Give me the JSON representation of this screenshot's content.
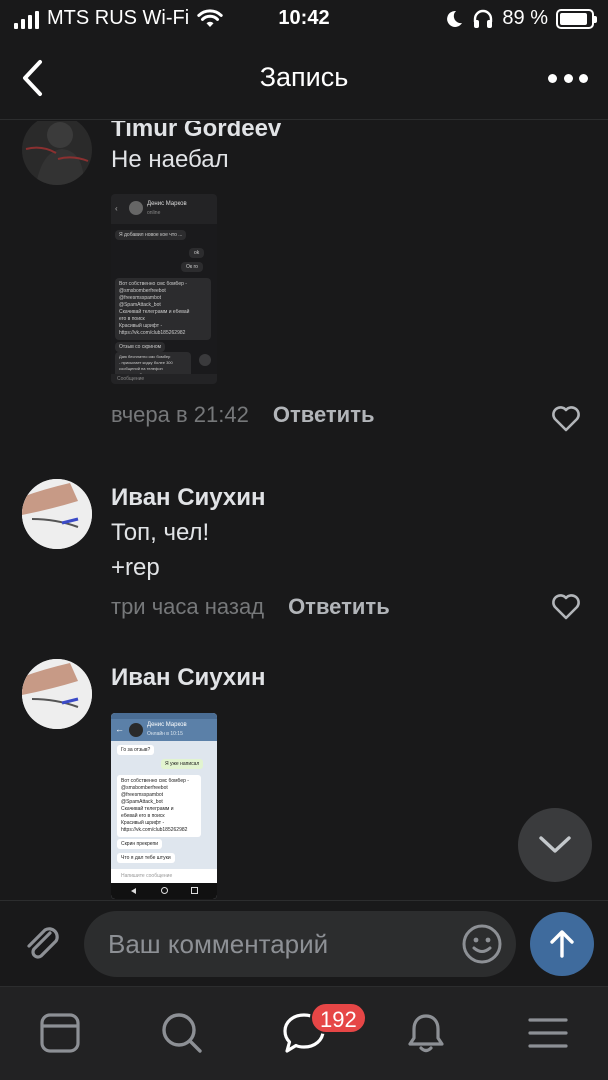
{
  "status_bar": {
    "carrier": "MTS RUS Wi-Fi",
    "time": "10:42",
    "battery": "89 %",
    "battery_level": 0.89
  },
  "header": {
    "title": "Запись",
    "back_icon": "chevron-left-icon",
    "more_icon": "more-horizontal-icon"
  },
  "comments": [
    {
      "author": "Timur Gordeev",
      "text": "Не наебал",
      "time": "вчера в 21:42",
      "reply": "Ответить",
      "attachment": {
        "chat_name": "Денис Марков",
        "chat_status": "online",
        "msg_1": "Я добавил новое кое что ...",
        "msg_2": "ok",
        "msg_3": "Ок го",
        "msg_4_lines": [
          "Вот собственно смс бомбер -",
          "@smsbomberfreebot",
          "@freesmsspambot",
          "@SpamAttack_bot",
          "Скачивай телеграмм и ебевай",
          "его в поиск",
          "Красивый шрифт -",
          "https://vk.com/club185262982"
        ],
        "msg_5": "Отзыв со скрином",
        "msg_6_lines": [
          "Даю бесплатно смс бомбер",
          "- присылает кидку более 300",
          "сообщений на телефон",
          "также даю бесплатно кое"
        ],
        "input_placeholder": "Сообщение"
      }
    },
    {
      "author": "Иван Сиухин",
      "text_lines": [
        "Топ, чел!",
        "+rep"
      ],
      "time": "три часа назад",
      "reply": "Ответить"
    },
    {
      "author": "Иван Сиухин",
      "attachment": {
        "chat_name": "Денис Марков",
        "chat_status": "Онлайн в 10:15",
        "msg_1": "Го за отзыв?",
        "msg_2": "Я уже написал",
        "msg_3_lines": [
          "Вот собственно смс бомбер -",
          "@smsbomberfreebot",
          "@freesmsspambot",
          "@SpamAttack_bot",
          "Скачивай телеграмм и",
          "ебевай его в поиск",
          "Красивый шрифт -",
          "https://vk.com/club185262982"
        ],
        "msg_4": "Скрин прекрепи",
        "msg_5": "Что я дал тебе штуки",
        "input_placeholder": "Напишите сообщение"
      }
    }
  ],
  "composer": {
    "placeholder": "Ваш комментарий"
  },
  "tab_bar": {
    "items": [
      "news-icon",
      "search-icon",
      "messages-icon",
      "notifications-icon",
      "menu-icon"
    ],
    "messages_badge": "192"
  },
  "colors": {
    "background": "#19191a",
    "text": "#e1e3e6",
    "secondary": "#76787a",
    "accent": "#3f6b9d",
    "badge": "#e64646"
  }
}
